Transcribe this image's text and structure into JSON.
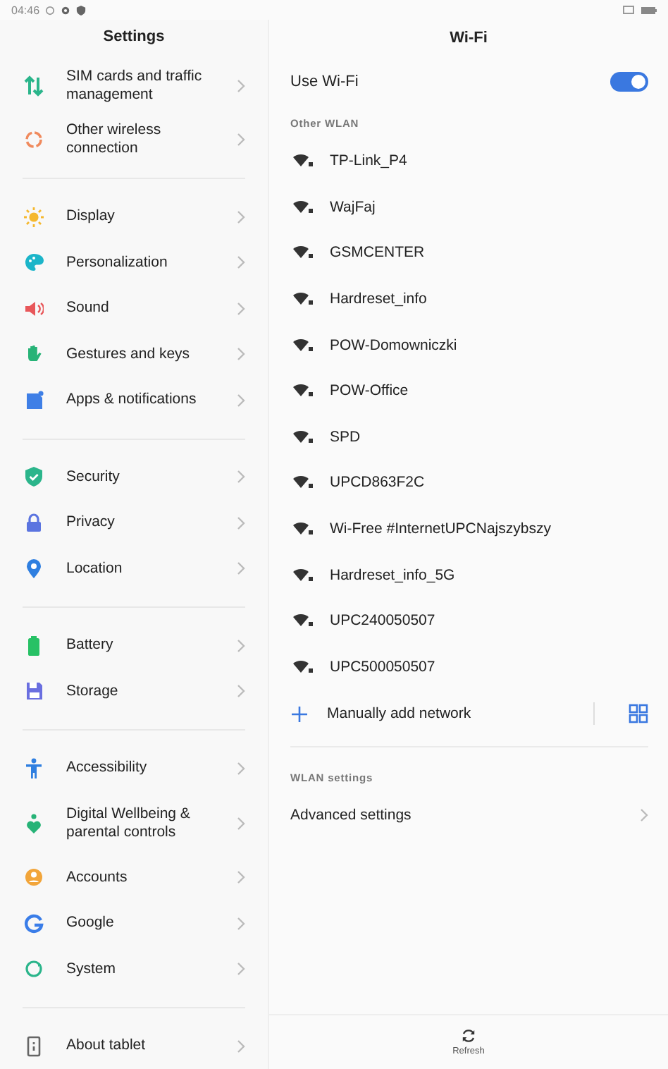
{
  "status_bar": {
    "time": "04:46"
  },
  "settings": {
    "title": "Settings",
    "groups": [
      {
        "items": [
          {
            "label": "SIM cards and traffic management"
          },
          {
            "label": "Other wireless connection"
          }
        ]
      },
      {
        "items": [
          {
            "label": "Display"
          },
          {
            "label": "Personalization"
          },
          {
            "label": "Sound"
          },
          {
            "label": "Gestures and keys"
          },
          {
            "label": "Apps & notifications"
          }
        ]
      },
      {
        "items": [
          {
            "label": "Security"
          },
          {
            "label": "Privacy"
          },
          {
            "label": "Location"
          }
        ]
      },
      {
        "items": [
          {
            "label": "Battery"
          },
          {
            "label": "Storage"
          }
        ]
      },
      {
        "items": [
          {
            "label": "Accessibility"
          },
          {
            "label": "Digital Wellbeing & parental controls"
          },
          {
            "label": "Accounts"
          },
          {
            "label": "Google"
          },
          {
            "label": "System"
          }
        ]
      },
      {
        "items": [
          {
            "label": "About tablet"
          }
        ]
      }
    ]
  },
  "wifi": {
    "title": "Wi-Fi",
    "use_wifi": {
      "label": "Use Wi-Fi",
      "on": true
    },
    "other_wlan": {
      "heading": "Other WLAN",
      "networks": [
        {
          "name": "TP-Link_P4"
        },
        {
          "name": "WajFaj"
        },
        {
          "name": "GSMCENTER"
        },
        {
          "name": "Hardreset_info"
        },
        {
          "name": "POW-Domowniczki"
        },
        {
          "name": "POW-Office"
        },
        {
          "name": "SPD"
        },
        {
          "name": "UPCD863F2C"
        },
        {
          "name": "Wi-Free #InternetUPCNajszybszy"
        },
        {
          "name": "Hardreset_info_5G"
        },
        {
          "name": "UPC240050507"
        },
        {
          "name": "UPC500050507"
        }
      ]
    },
    "add_network": {
      "label": "Manually add network"
    },
    "wlan_settings": {
      "heading": "WLAN settings",
      "items": [
        {
          "label": "Advanced settings"
        }
      ]
    },
    "refresh": {
      "label": "Refresh"
    }
  }
}
